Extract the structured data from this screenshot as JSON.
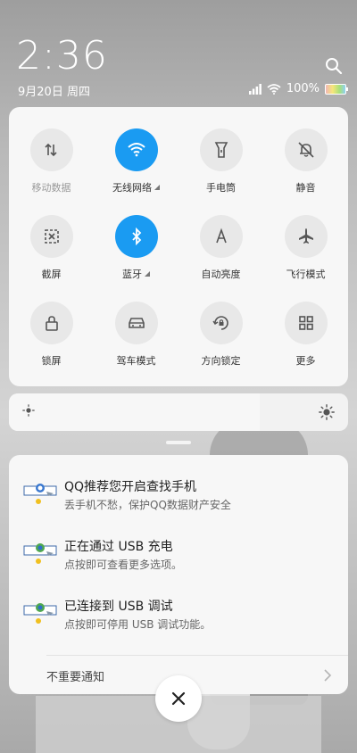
{
  "status_bar": {
    "time": "2:36",
    "date": "9月20日 周四",
    "battery_percent": "100%"
  },
  "quick_settings": [
    {
      "label": "移动数据",
      "active": false,
      "dim": true,
      "icon": "mobile-data-icon"
    },
    {
      "label": "无线网络",
      "active": true,
      "dim": false,
      "icon": "wifi-icon",
      "expandable": true
    },
    {
      "label": "手电筒",
      "active": false,
      "dim": false,
      "icon": "flashlight-icon"
    },
    {
      "label": "静音",
      "active": false,
      "dim": false,
      "icon": "mute-bell-icon"
    },
    {
      "label": "截屏",
      "active": false,
      "dim": false,
      "icon": "screenshot-icon"
    },
    {
      "label": "蓝牙",
      "active": true,
      "dim": false,
      "icon": "bluetooth-icon",
      "expandable": true
    },
    {
      "label": "自动亮度",
      "active": false,
      "dim": false,
      "icon": "auto-brightness-icon"
    },
    {
      "label": "飞行模式",
      "active": false,
      "dim": false,
      "icon": "airplane-icon"
    },
    {
      "label": "锁屏",
      "active": false,
      "dim": false,
      "icon": "lock-icon"
    },
    {
      "label": "驾车模式",
      "active": false,
      "dim": false,
      "icon": "car-icon"
    },
    {
      "label": "方向锁定",
      "active": false,
      "dim": false,
      "icon": "rotation-lock-icon"
    },
    {
      "label": "更多",
      "active": false,
      "dim": false,
      "icon": "grid-icon"
    }
  ],
  "brightness": {
    "level_percent": 74
  },
  "notifications": [
    {
      "title": "QQ推荐您开启查找手机",
      "subtitle": "丢手机不愁，保护QQ数据财产安全"
    },
    {
      "title": "正在通过 USB 充电",
      "subtitle": "点按即可查看更多选项。"
    },
    {
      "title": "已连接到 USB 调试",
      "subtitle": "点按即可停用 USB 调试功能。"
    }
  ],
  "unimportant_label": "不重要通知",
  "colors": {
    "accent": "#1a9bf2",
    "tile_off": "#e8e8e8",
    "panel": "#f7f7f7"
  }
}
